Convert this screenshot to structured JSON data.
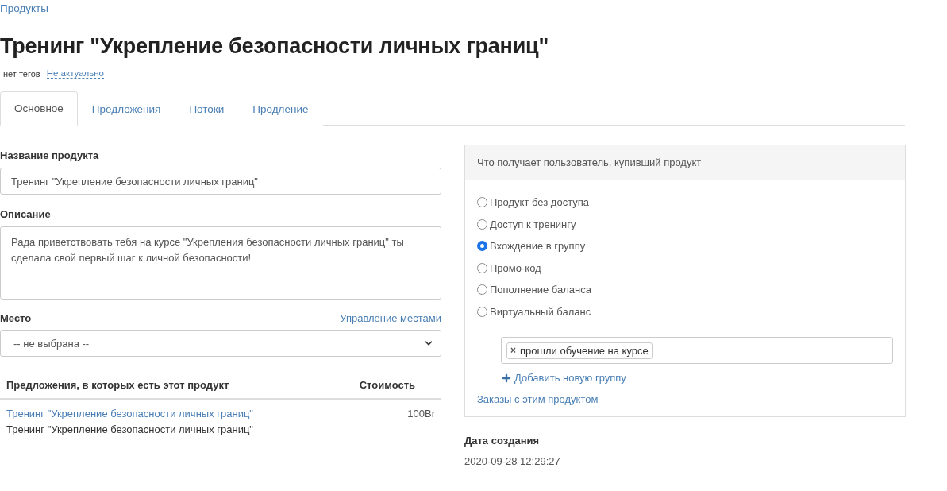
{
  "breadcrumb": "Продукты",
  "title": "Тренинг \"Укрепление безопасности личных границ\"",
  "tags": {
    "label": "нет тегов",
    "status_link": "Не актуально"
  },
  "tabs": [
    {
      "label": "Основное",
      "selected": true
    },
    {
      "label": "Предложения",
      "selected": false
    },
    {
      "label": "Потоки",
      "selected": false
    },
    {
      "label": "Продление",
      "selected": false
    }
  ],
  "form": {
    "name_label": "Название продукта",
    "name_value": "Тренинг \"Укрепление безопасности личных границ\"",
    "description_label": "Описание",
    "description_value": "Рада приветствовать тебя на курсе \"Укрепления безопасности личных границ\" ты сделала свой первый шаг к личной безопасности!",
    "place_label": "Место",
    "place_link": "Управление местами",
    "place_value": "-- не выбрана --"
  },
  "offers_table": {
    "columns": [
      "Предложения, в которых есть этот продукт",
      "Стоимость"
    ],
    "rows": [
      {
        "link": "Тренинг \"Укрепление безопасности личных границ\"",
        "subtitle": "Тренинг \"Укрепление безопасности личных границ\"",
        "price": "100Br"
      }
    ]
  },
  "access_panel": {
    "header": "Что получает пользователь, купивший продукт",
    "options": [
      {
        "label": "Продукт без доступа",
        "selected": false
      },
      {
        "label": "Доступ к тренингу",
        "selected": false
      },
      {
        "label": "Вхождение в группу",
        "selected": true
      },
      {
        "label": "Промо-код",
        "selected": false
      },
      {
        "label": "Пополнение баланса",
        "selected": false
      },
      {
        "label": "Виртуальный баланс",
        "selected": false
      }
    ],
    "groups": [
      {
        "remove": "×",
        "label": "прошли обучение на курсе"
      }
    ],
    "add_group": "Добавить новую группу",
    "orders_link": "Заказы с этим продуктом"
  },
  "created": {
    "label": "Дата создания",
    "value": "2020-09-28 12:29:27"
  }
}
